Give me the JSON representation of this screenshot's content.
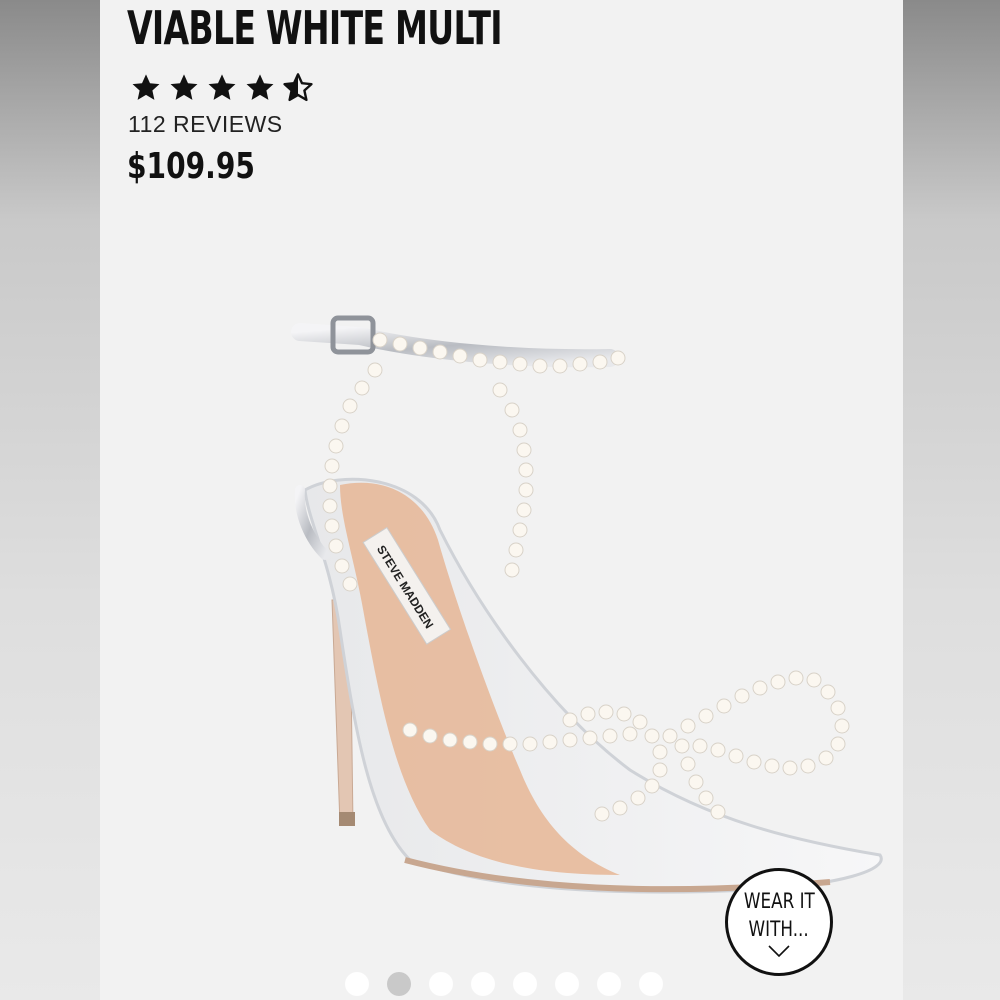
{
  "product": {
    "name": "VIABLE WHITE MULTI",
    "rating": 4.5,
    "rating_max": 5,
    "reviews_label": "112 REVIEWS",
    "price": "$109.95",
    "image_icon": "pearl-bow-heel-sandal",
    "brand_insole": "STEVE MADDEN"
  },
  "wear_it_with": {
    "line1": "WEAR IT",
    "line2": "WITH...",
    "icon": "chevron-down-icon"
  },
  "carousel": {
    "total": 8,
    "active_index": 1
  },
  "colors": {
    "panel": "#f2f2f2",
    "text": "#111111",
    "dot_active": "#c9c9c9",
    "dot_inactive": "#ffffff"
  }
}
